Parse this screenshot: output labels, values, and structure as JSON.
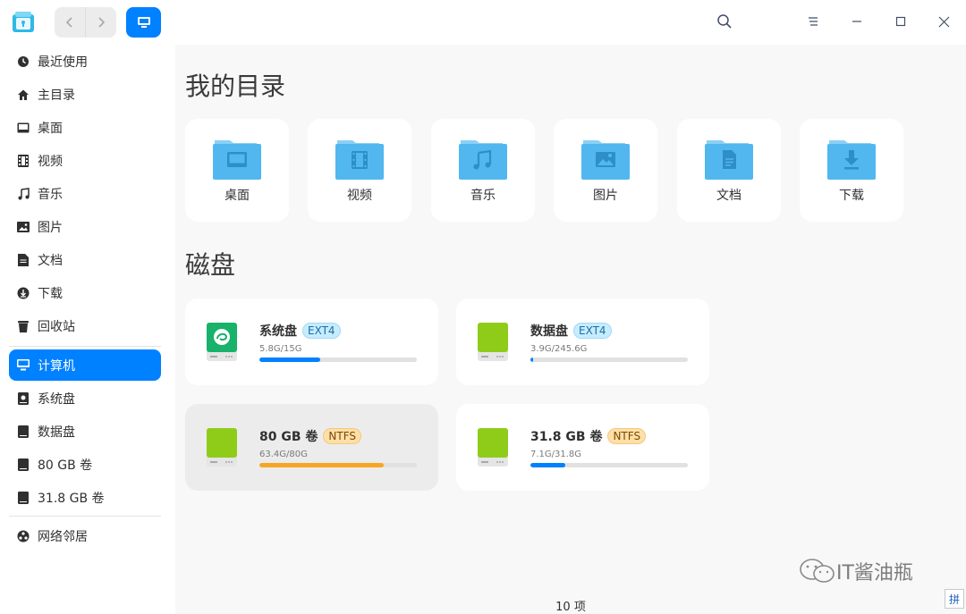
{
  "titlebar": {
    "back_icon": "chevron-left-icon",
    "forward_icon": "chevron-right-icon",
    "view_icon": "computer-icon"
  },
  "sidebar": {
    "items": [
      {
        "label": "最近使用",
        "icon": "clock-icon"
      },
      {
        "label": "主目录",
        "icon": "home-icon"
      },
      {
        "label": "桌面",
        "icon": "desktop-icon"
      },
      {
        "label": "视频",
        "icon": "film-icon"
      },
      {
        "label": "音乐",
        "icon": "music-icon"
      },
      {
        "label": "图片",
        "icon": "image-icon"
      },
      {
        "label": "文档",
        "icon": "document-icon"
      },
      {
        "label": "下载",
        "icon": "download-icon"
      },
      {
        "label": "回收站",
        "icon": "trash-icon"
      },
      {
        "label": "计算机",
        "icon": "computer-icon",
        "active": true
      },
      {
        "label": "系统盘",
        "icon": "disk-icon"
      },
      {
        "label": "数据盘",
        "icon": "disk-icon"
      },
      {
        "label": "80 GB 卷",
        "icon": "disk-icon"
      },
      {
        "label": "31.8 GB 卷",
        "icon": "disk-icon"
      },
      {
        "label": "网络邻居",
        "icon": "network-icon"
      }
    ]
  },
  "main": {
    "dirs_title": "我的目录",
    "folders": [
      {
        "label": "桌面",
        "icon": "desktop-icon"
      },
      {
        "label": "视频",
        "icon": "film-icon"
      },
      {
        "label": "音乐",
        "icon": "music-icon"
      },
      {
        "label": "图片",
        "icon": "image-icon"
      },
      {
        "label": "文档",
        "icon": "document-icon"
      },
      {
        "label": "下载",
        "icon": "download-icon"
      }
    ],
    "disks_title": "磁盘",
    "disks": [
      {
        "name": "系统盘",
        "fs": "EXT4",
        "usage": "5.8G/15G",
        "fraction": 0.387,
        "color": "#0081ff"
      },
      {
        "name": "数据盘",
        "fs": "EXT4",
        "usage": "3.9G/245.6G",
        "fraction": 0.016,
        "color": "#0081ff"
      },
      {
        "name": "80 GB 卷",
        "fs": "NTFS",
        "usage": "63.4G/80G",
        "fraction": 0.79,
        "color": "#f6a623"
      },
      {
        "name": "31.8 GB 卷",
        "fs": "NTFS",
        "usage": "7.1G/31.8G",
        "fraction": 0.223,
        "color": "#0081ff"
      }
    ],
    "status": "10 项"
  },
  "colors": {
    "accent": "#0081ff",
    "folder": "#52b7ef",
    "disk_green": "#8fcc1a"
  },
  "watermark": "IT酱油瓶",
  "ime_label": "拼"
}
